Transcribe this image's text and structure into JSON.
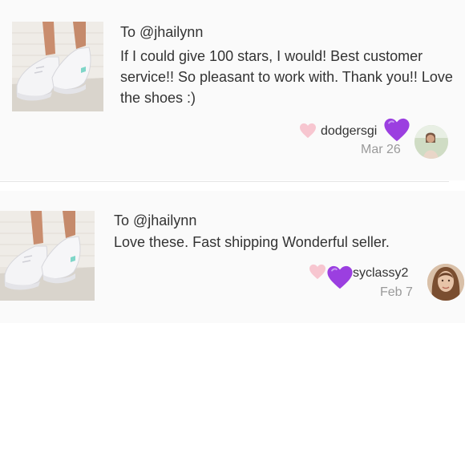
{
  "reviews": [
    {
      "recipient": "To @jhailynn",
      "text": "If I could give 100 stars, I would! Best customer service!! So pleasant to work with. Thank you!! Love the shoes :)",
      "username": "dodgersgi",
      "date": "Mar 26",
      "product_image": "white-knit-sneakers-photo",
      "avatar_image": "user-avatar-photo"
    },
    {
      "recipient": "To @jhailynn",
      "text": "Love these. Fast shipping Wonderful seller.",
      "username": "syclassy2",
      "date": "Feb 7",
      "product_image": "white-knit-sneakers-photo",
      "avatar_image": "user-avatar-photo"
    }
  ],
  "colors": {
    "card_background": "#fafafa",
    "text": "#333333",
    "date_text": "#9a9a9a",
    "like_heart": "#f7c6d0",
    "purple_heart": "#9b3fe0",
    "divider": "#e6e6e6"
  }
}
